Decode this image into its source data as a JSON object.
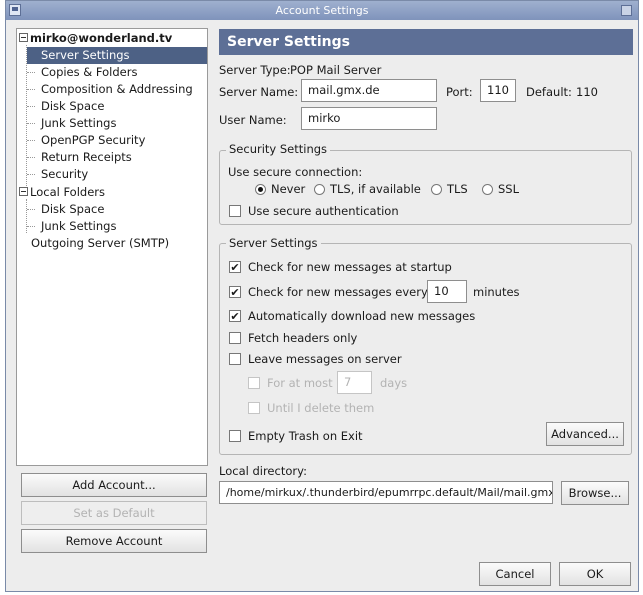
{
  "window": {
    "title": "Account Settings"
  },
  "tree": {
    "account": "mirko@wonderland.tv",
    "account_items": [
      "Server Settings",
      "Copies & Folders",
      "Composition & Addressing",
      "Disk Space",
      "Junk Settings",
      "OpenPGP Security",
      "Return Receipts",
      "Security"
    ],
    "local_folders": "Local Folders",
    "local_items": [
      "Disk Space",
      "Junk Settings"
    ],
    "outgoing": "Outgoing Server (SMTP)"
  },
  "left_buttons": {
    "add": "Add Account...",
    "default": "Set as Default",
    "remove": "Remove Account"
  },
  "panel": {
    "title": "Server Settings",
    "server_type_label": "Server Type:",
    "server_type_value": "POP Mail Server",
    "server_name_label": "Server Name:",
    "server_name_value": "mail.gmx.de",
    "port_label": "Port:",
    "port_value": "110",
    "default_label": "Default:",
    "default_value": "110",
    "user_name_label": "User Name:",
    "user_name_value": "mirko"
  },
  "security": {
    "title": "Security Settings",
    "use_secure_label": "Use secure connection:",
    "options": [
      "Never",
      "TLS, if available",
      "TLS",
      "SSL"
    ],
    "selected": "Never",
    "secure_auth_label": "Use secure authentication",
    "secure_auth_checked": false
  },
  "server": {
    "title": "Server Settings",
    "check_startup": "Check for new messages at startup",
    "check_every": "Check for new messages every",
    "check_every_value": "10",
    "minutes": "minutes",
    "auto_download": "Automatically download new messages",
    "fetch_headers": "Fetch headers only",
    "leave_messages": "Leave messages on server",
    "for_at_most": "For at most",
    "days_value": "7",
    "days": "days",
    "until_delete": "Until I delete them",
    "empty_trash": "Empty Trash on Exit",
    "advanced": "Advanced..."
  },
  "local_dir": {
    "label": "Local directory:",
    "path": "/home/mirkux/.thunderbird/epumrrpc.default/Mail/mail.gmx.de",
    "browse": "Browse..."
  },
  "footer": {
    "cancel": "Cancel",
    "ok": "OK"
  },
  "colors": {
    "header": "#5d6f96",
    "selection": "#4d6185",
    "titlebar": "#8fa2c6"
  }
}
